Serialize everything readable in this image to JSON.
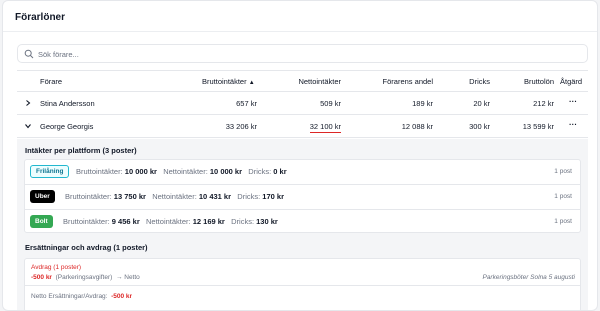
{
  "page": {
    "title": "Förarlöner"
  },
  "search": {
    "placeholder": "Sök förare..."
  },
  "table": {
    "headers": {
      "driver": "Förare",
      "gross": "Bruttointäkter",
      "net": "Nettointäkter",
      "share": "Förarens andel",
      "tips": "Dricks",
      "gross_salary": "Bruttolön",
      "action": "Åtgärd"
    },
    "sort_indicator": "▲",
    "rows": [
      {
        "name": "Stina Andersson",
        "gross": "657 kr",
        "net": "509 kr",
        "share": "189 kr",
        "tips": "20 kr",
        "gross_salary": "212 kr",
        "action": "···"
      },
      {
        "name": "George Georgis",
        "gross": "33 206 kr",
        "net": "32 100 kr",
        "share": "12 088 kr",
        "tips": "300 kr",
        "gross_salary": "13 599 kr",
        "action": "···"
      }
    ]
  },
  "detail": {
    "platform_title": "Intäkter per plattform (3 poster)",
    "labels": {
      "gross": "Bruttointäkter:",
      "net": "Nettointäkter:",
      "tips": "Dricks:"
    },
    "platforms": [
      {
        "badge": "Frilåning",
        "gross": "10 000 kr",
        "net": "10 000 kr",
        "tips": "0 kr",
        "count": "1 post"
      },
      {
        "badge": "Uber",
        "gross": "13 750 kr",
        "net": "10 431 kr",
        "tips": "170 kr",
        "count": "1 post"
      },
      {
        "badge": "Bolt",
        "gross": "9 456 kr",
        "net": "12 169 kr",
        "tips": "130 kr",
        "count": "1 post"
      }
    ],
    "comp_title": "Ersättningar och avdrag (1 poster)",
    "deductions": {
      "heading": "Avdrag (1 poster)",
      "amount": "-500 kr",
      "category": "(Parkeringsavgifter)",
      "target": "→ Netto",
      "note": "Parkeringsböter Solna 5 augusti"
    },
    "net_label": "Netto Ersättningar/Avdrag:",
    "net_value": "-500 kr"
  },
  "colors": {
    "negative": "#dc2626",
    "uber": "#000000",
    "bolt": "#34a853",
    "frilaning_border": "#22b8cf"
  }
}
